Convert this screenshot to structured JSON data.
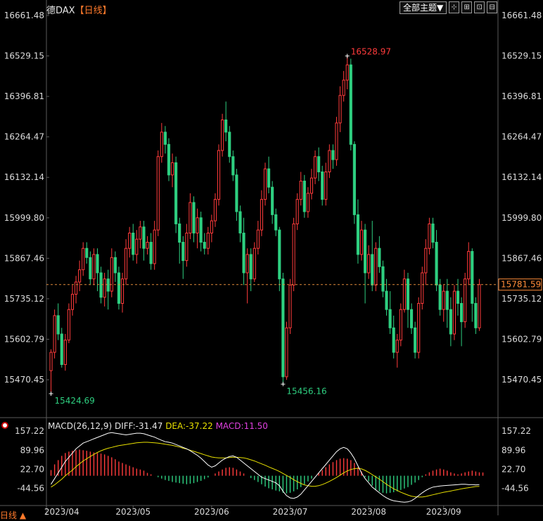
{
  "header": {
    "title": "德DAX",
    "period_tag": "【日线】"
  },
  "toolbar": {
    "theme_label": "全部主题▼",
    "icons": [
      "crosshair-icon",
      "candle-chart-icon",
      "zoom-icon",
      "fullscreen-icon"
    ],
    "icon_glyphs": [
      "⊹",
      "⊞",
      "⊡",
      "⊟"
    ]
  },
  "macd": {
    "params": "MACD(26,12,9)",
    "diff": "DIFF:-31.47",
    "dea": "DEA:-37.22",
    "macd": "MACD:11.50"
  },
  "footer": {
    "period": "日线 ▲"
  },
  "colors": {
    "up": "#ff3b3b",
    "down": "#2ecf80",
    "diff": "#ffffff",
    "dea": "#e8e000",
    "dashed": "#e08a3a",
    "price_box": "#ff8c3a"
  },
  "chart_data": {
    "type": "candlestick",
    "y_ticks": [
      15470.45,
      15602.79,
      15735.12,
      15867.46,
      15999.8,
      16132.14,
      16264.47,
      16396.81,
      16529.15,
      16661.48
    ],
    "y_tick_labels": [
      "15470.45",
      "15602.79",
      "15735.12",
      "15867.46",
      "15999.80",
      "16132.14",
      "16264.47",
      "16396.81",
      "16529.15",
      "16661.48"
    ],
    "ylim": [
      15420,
      16661.48
    ],
    "x_labels": [
      "2023/04",
      "2023/05",
      "2023/06",
      "2023/07",
      "2023/08",
      "2023/09"
    ],
    "x_label_index": [
      3,
      23,
      45,
      67,
      89,
      110
    ],
    "current_price": 15781.59,
    "current_price_label": "15781.59",
    "annotations": [
      {
        "index": 0,
        "value": 15424.69,
        "label": "15424.69",
        "color": "#2ecf80"
      },
      {
        "index": 65,
        "value": 15456.16,
        "label": "15456.16",
        "color": "#2ecf80"
      },
      {
        "index": 83,
        "value": 16528.97,
        "label": "16528.97",
        "color": "#ff3b3b"
      }
    ],
    "candles": [
      [
        15500,
        15560,
        15424.69,
        15570
      ],
      [
        15560,
        15680,
        15540,
        15700
      ],
      [
        15680,
        15620,
        15600,
        15720
      ],
      [
        15620,
        15520,
        15510,
        15640
      ],
      [
        15520,
        15600,
        15500,
        15620
      ],
      [
        15600,
        15700,
        15590,
        15720
      ],
      [
        15700,
        15750,
        15680,
        15780
      ],
      [
        15750,
        15790,
        15720,
        15810
      ],
      [
        15790,
        15830,
        15760,
        15860
      ],
      [
        15830,
        15900,
        15810,
        15920
      ],
      [
        15900,
        15870,
        15850,
        15920
      ],
      [
        15870,
        15800,
        15780,
        15890
      ],
      [
        15800,
        15880,
        15780,
        15900
      ],
      [
        15880,
        15820,
        15760,
        15900
      ],
      [
        15820,
        15740,
        15720,
        15840
      ],
      [
        15740,
        15800,
        15710,
        15820
      ],
      [
        15800,
        15760,
        15700,
        15830
      ],
      [
        15760,
        15870,
        15740,
        15900
      ],
      [
        15870,
        15820,
        15790,
        15890
      ],
      [
        15820,
        15720,
        15700,
        15840
      ],
      [
        15720,
        15800,
        15690,
        15820
      ],
      [
        15800,
        15900,
        15780,
        15930
      ],
      [
        15900,
        15950,
        15870,
        15970
      ],
      [
        15950,
        15880,
        15860,
        15980
      ],
      [
        15880,
        15930,
        15850,
        15960
      ],
      [
        15930,
        15970,
        15900,
        15990
      ],
      [
        15970,
        15900,
        15860,
        15990
      ],
      [
        15900,
        15920,
        15880,
        15940
      ],
      [
        15920,
        15850,
        15830,
        15950
      ],
      [
        15850,
        15960,
        15830,
        15990
      ],
      [
        15960,
        16200,
        15940,
        16220
      ],
      [
        16200,
        16280,
        16180,
        16310
      ],
      [
        16280,
        16240,
        16210,
        16300
      ],
      [
        16240,
        16140,
        16120,
        16260
      ],
      [
        16140,
        16180,
        16100,
        16210
      ],
      [
        16180,
        15980,
        15950,
        16200
      ],
      [
        15980,
        15920,
        15850,
        16000
      ],
      [
        15920,
        15860,
        15800,
        15940
      ],
      [
        15860,
        15950,
        15840,
        15980
      ],
      [
        15950,
        16050,
        15930,
        16080
      ],
      [
        16050,
        15950,
        15920,
        16070
      ],
      [
        15950,
        16000,
        15900,
        16030
      ],
      [
        16000,
        15920,
        15890,
        16020
      ],
      [
        15920,
        15900,
        15880,
        15950
      ],
      [
        15900,
        15950,
        15880,
        15970
      ],
      [
        15950,
        15990,
        15920,
        16010
      ],
      [
        15990,
        16060,
        15970,
        16080
      ],
      [
        16060,
        16220,
        16040,
        16240
      ],
      [
        16220,
        16320,
        16200,
        16340
      ],
      [
        16320,
        16280,
        16250,
        16380
      ],
      [
        16280,
        16200,
        16180,
        16300
      ],
      [
        16200,
        16140,
        16120,
        16220
      ],
      [
        16140,
        16020,
        15990,
        16160
      ],
      [
        16020,
        15950,
        15920,
        16040
      ],
      [
        15950,
        15820,
        15780,
        16000
      ],
      [
        15820,
        15880,
        15720,
        15900
      ],
      [
        15880,
        15800,
        15760,
        15900
      ],
      [
        15800,
        15900,
        15790,
        15920
      ],
      [
        15900,
        15960,
        15880,
        15990
      ],
      [
        15960,
        16060,
        15940,
        16090
      ],
      [
        16060,
        16160,
        16040,
        16180
      ],
      [
        16160,
        16100,
        16080,
        16200
      ],
      [
        16100,
        16010,
        15980,
        16120
      ],
      [
        16010,
        15960,
        15940,
        16030
      ],
      [
        15960,
        15800,
        15760,
        15970
      ],
      [
        15800,
        15480,
        15456.16,
        15820
      ],
      [
        15480,
        15640,
        15470,
        15660
      ],
      [
        15640,
        15780,
        15620,
        15800
      ],
      [
        15780,
        15980,
        15760,
        16000
      ],
      [
        15980,
        16060,
        15960,
        16080
      ],
      [
        16060,
        16120,
        16040,
        16150
      ],
      [
        16120,
        16020,
        16000,
        16140
      ],
      [
        16020,
        16080,
        16000,
        16100
      ],
      [
        16080,
        16130,
        16060,
        16160
      ],
      [
        16130,
        16200,
        16110,
        16220
      ],
      [
        16200,
        16150,
        16120,
        16230
      ],
      [
        16150,
        16060,
        16040,
        16170
      ],
      [
        16060,
        16150,
        16040,
        16180
      ],
      [
        16150,
        16220,
        16130,
        16240
      ],
      [
        16220,
        16190,
        16160,
        16240
      ],
      [
        16190,
        16310,
        16170,
        16330
      ],
      [
        16310,
        16400,
        16280,
        16430
      ],
      [
        16400,
        16450,
        16380,
        16480
      ],
      [
        16450,
        16500,
        16420,
        16528.97
      ],
      [
        16500,
        16240,
        16220,
        16520
      ],
      [
        16240,
        16010,
        15980,
        16250
      ],
      [
        16010,
        15880,
        15850,
        16060
      ],
      [
        15880,
        15960,
        15860,
        15990
      ],
      [
        15960,
        15820,
        15720,
        15980
      ],
      [
        15820,
        15880,
        15800,
        15910
      ],
      [
        15880,
        15780,
        15760,
        15990
      ],
      [
        15780,
        15900,
        15760,
        15920
      ],
      [
        15900,
        15840,
        15820,
        15940
      ],
      [
        15840,
        15760,
        15740,
        15860
      ],
      [
        15760,
        15700,
        15680,
        15800
      ],
      [
        15700,
        15640,
        15620,
        15760
      ],
      [
        15640,
        15560,
        15540,
        15680
      ],
      [
        15560,
        15600,
        15510,
        15620
      ],
      [
        15600,
        15700,
        15580,
        15720
      ],
      [
        15700,
        15800,
        15690,
        15830
      ],
      [
        15800,
        15700,
        15640,
        15820
      ],
      [
        15700,
        15640,
        15620,
        15720
      ],
      [
        15640,
        15560,
        15540,
        15660
      ],
      [
        15560,
        15720,
        15540,
        15740
      ],
      [
        15720,
        15820,
        15700,
        15840
      ],
      [
        15820,
        15900,
        15780,
        15930
      ],
      [
        15900,
        15980,
        15880,
        16000
      ],
      [
        15980,
        15920,
        15900,
        16000
      ],
      [
        15920,
        15780,
        15760,
        15960
      ],
      [
        15780,
        15700,
        15680,
        15800
      ],
      [
        15700,
        15760,
        15660,
        15780
      ],
      [
        15760,
        15700,
        15640,
        15800
      ],
      [
        15700,
        15620,
        15580,
        15740
      ],
      [
        15620,
        15760,
        15600,
        15780
      ],
      [
        15760,
        15720,
        15680,
        15800
      ],
      [
        15720,
        15660,
        15580,
        15740
      ],
      [
        15660,
        15800,
        15640,
        15820
      ],
      [
        15800,
        15890,
        15780,
        15920
      ],
      [
        15890,
        15720,
        15660,
        15900
      ],
      [
        15720,
        15640,
        15620,
        15740
      ],
      [
        15640,
        15781.59,
        15630,
        15800
      ]
    ],
    "macd_ticks": [
      157.22,
      89.96,
      22.7,
      -44.56
    ],
    "macd_tick_labels": [
      "157.22",
      "89.96",
      "22.70",
      "-44.56"
    ],
    "macd_ylim": [
      -95,
      165
    ],
    "diff": [
      -30,
      -10,
      10,
      30,
      50,
      65,
      80,
      95,
      105,
      115,
      120,
      125,
      130,
      135,
      140,
      145,
      150,
      152,
      150,
      148,
      146,
      144,
      146,
      148,
      150,
      150,
      148,
      144,
      140,
      136,
      130,
      125,
      120,
      118,
      115,
      110,
      105,
      100,
      95,
      88,
      80,
      72,
      62,
      50,
      38,
      30,
      35,
      45,
      55,
      62,
      68,
      70,
      65,
      55,
      45,
      35,
      25,
      15,
      5,
      -5,
      -10,
      -15,
      -20,
      -25,
      -35,
      -55,
      -70,
      -78,
      -80,
      -75,
      -65,
      -50,
      -35,
      -20,
      -5,
      10,
      25,
      40,
      55,
      70,
      85,
      95,
      100,
      95,
      80,
      60,
      35,
      10,
      -10,
      -25,
      -40,
      -50,
      -60,
      -70,
      -78,
      -84,
      -88,
      -90,
      -92,
      -93,
      -92,
      -88,
      -80,
      -70,
      -60,
      -52,
      -45,
      -40,
      -38,
      -36,
      -35,
      -34,
      -33,
      -32,
      -31,
      -30,
      -30,
      -31,
      -31,
      -32,
      -31.47
    ],
    "dea": [
      -40,
      -32,
      -22,
      -12,
      0,
      10,
      20,
      32,
      42,
      52,
      60,
      68,
      75,
      82,
      88,
      93,
      97,
      100,
      103,
      106,
      108,
      110,
      112,
      114,
      116,
      117,
      118,
      118,
      117,
      116,
      115,
      113,
      111,
      109,
      107,
      104,
      101,
      97,
      94,
      90,
      86,
      82,
      78,
      74,
      70,
      66,
      64,
      63,
      63,
      63,
      64,
      65,
      65,
      64,
      63,
      60,
      56,
      52,
      47,
      42,
      37,
      31,
      26,
      21,
      15,
      8,
      1,
      -6,
      -14,
      -21,
      -27,
      -32,
      -35,
      -37,
      -37,
      -35,
      -31,
      -26,
      -20,
      -13,
      -6,
      2,
      10,
      17,
      22,
      25,
      26,
      24,
      19,
      12,
      4,
      -4,
      -12,
      -21,
      -30,
      -38,
      -46,
      -52,
      -58,
      -63,
      -68,
      -72,
      -74,
      -75,
      -75,
      -73,
      -70,
      -67,
      -64,
      -61,
      -58,
      -56,
      -54,
      -51,
      -49,
      -46,
      -44,
      -42,
      -40,
      -38,
      -37.22
    ],
    "macd_hist": [
      20,
      40,
      55,
      70,
      80,
      85,
      88,
      90,
      92,
      90,
      88,
      85,
      82,
      80,
      78,
      75,
      70,
      65,
      58,
      50,
      45,
      40,
      35,
      30,
      25,
      22,
      18,
      10,
      5,
      0,
      -5,
      -10,
      -15,
      -18,
      -22,
      -24,
      -26,
      -28,
      -30,
      -28,
      -26,
      -22,
      -18,
      -12,
      -6,
      0,
      8,
      15,
      22,
      28,
      30,
      28,
      22,
      15,
      8,
      0,
      -8,
      -15,
      -22,
      -30,
      -38,
      -44,
      -48,
      -52,
      -55,
      -60,
      -62,
      -60,
      -55,
      -48,
      -40,
      -30,
      -20,
      -10,
      0,
      10,
      20,
      30,
      40,
      48,
      55,
      60,
      62,
      60,
      55,
      45,
      30,
      15,
      -5,
      -20,
      -35,
      -48,
      -55,
      -60,
      -62,
      -60,
      -58,
      -55,
      -50,
      -45,
      -40,
      -32,
      -24,
      -15,
      -5,
      5,
      12,
      18,
      22,
      25,
      22,
      18,
      12,
      8,
      5,
      8,
      12,
      15,
      18,
      15,
      12,
      11.5
    ]
  }
}
